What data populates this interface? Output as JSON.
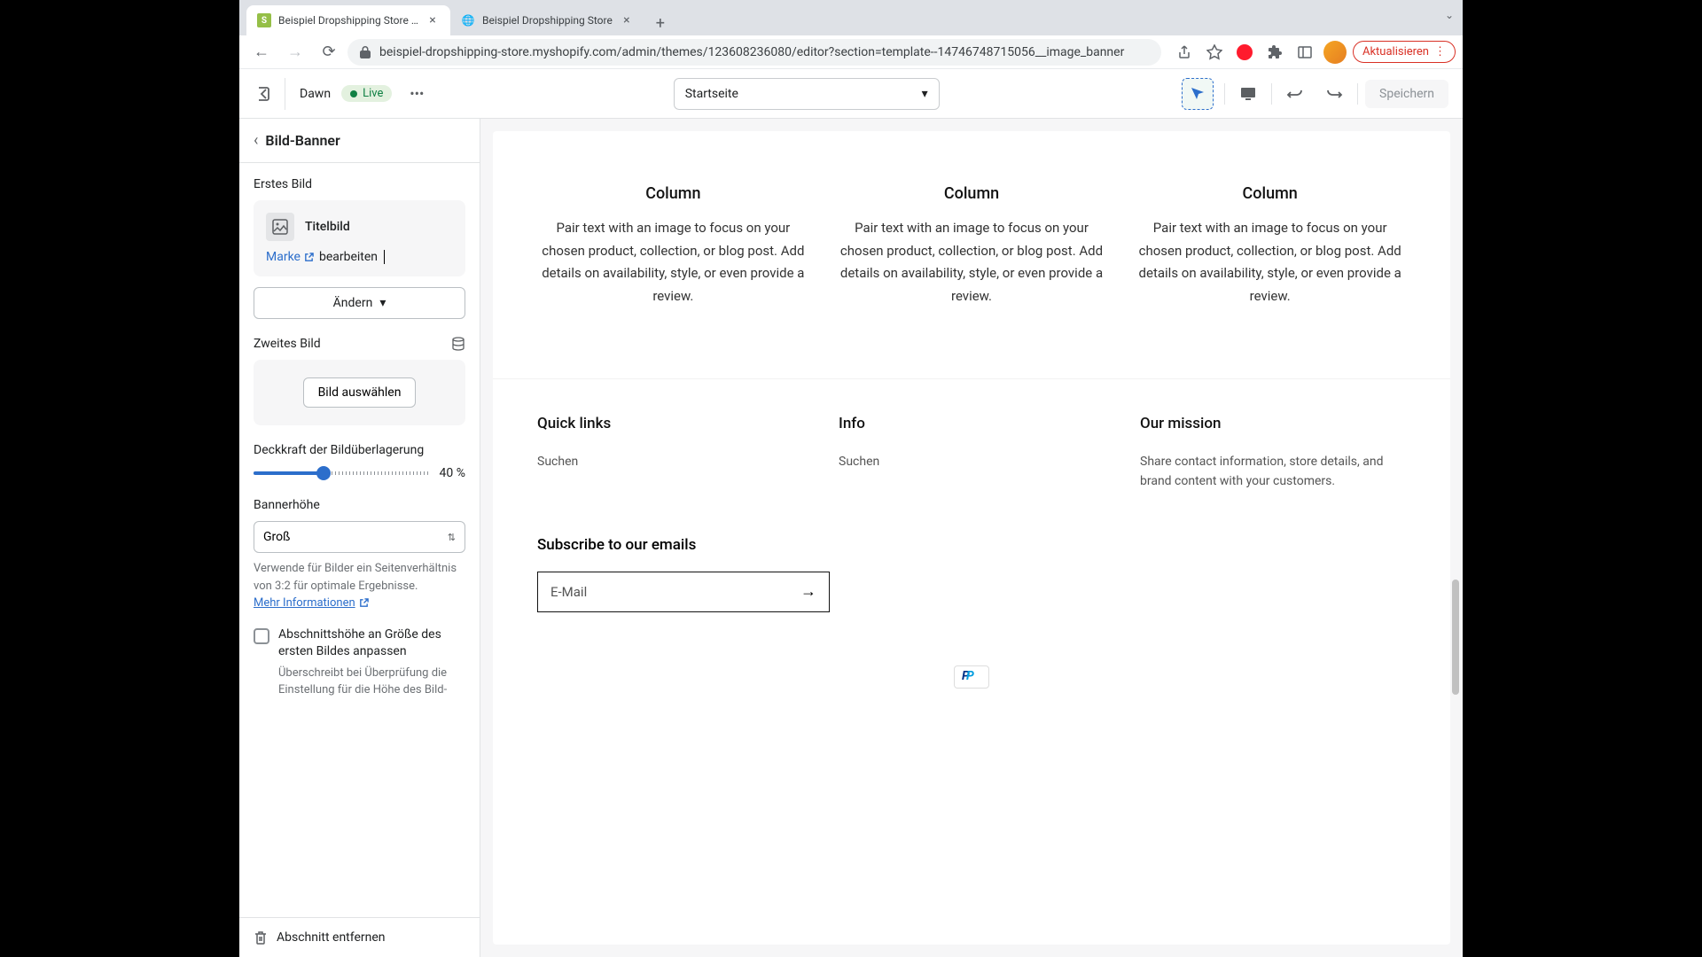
{
  "browser": {
    "tabs": [
      {
        "title": "Beispiel Dropshipping Store · D",
        "favicon_color": "#95bf47"
      },
      {
        "title": "Beispiel Dropshipping Store",
        "favicon_color": "#5c5f62"
      }
    ],
    "url": "beispiel-dropshipping-store.myshopify.com/admin/themes/123608236080/editor?section=template--14746748715056__image_banner",
    "refresh_label": "Aktualisieren"
  },
  "topbar": {
    "theme_name": "Dawn",
    "live_label": "Live",
    "page_selector": "Startseite",
    "save_label": "Speichern"
  },
  "sidebar": {
    "section_title": "Bild-Banner",
    "first_image_label": "Erstes Bild",
    "image_name": "Titelbild",
    "brand_link": "Marke",
    "edit_label": "bearbeiten",
    "change_btn": "Ändern",
    "second_image_label": "Zweites Bild",
    "select_image_btn": "Bild auswählen",
    "opacity_label": "Deckkraft der Bildüberlagerung",
    "opacity_value": "40 %",
    "opacity_percent": 40,
    "height_label": "Bannerhöhe",
    "height_value": "Groß",
    "height_help": "Verwende für Bilder ein Seitenverhältnis von 3:2 für optimale Ergebnisse.",
    "more_info": "Mehr Informationen",
    "checkbox_label": "Abschnittshöhe an Größe des ersten Bildes anpassen",
    "checkbox_help": "Überschreibt bei Überprüfung die Einstellung für die Höhe des Bild-",
    "remove_section": "Abschnitt entfernen"
  },
  "preview": {
    "columns": [
      {
        "title": "Column",
        "text": "Pair text with an image to focus on your chosen product, collection, or blog post. Add details on availability, style, or even provide a review."
      },
      {
        "title": "Column",
        "text": "Pair text with an image to focus on your chosen product, collection, or blog post. Add details on availability, style, or even provide a review."
      },
      {
        "title": "Column",
        "text": "Pair text with an image to focus on your chosen product, collection, or blog post. Add details on availability, style, or even provide a review."
      }
    ],
    "footer": {
      "quick_links_title": "Quick links",
      "quick_links_item": "Suchen",
      "info_title": "Info",
      "info_item": "Suchen",
      "mission_title": "Our mission",
      "mission_text": "Share contact information, store details, and brand content with your customers."
    },
    "subscribe": {
      "title": "Subscribe to our emails",
      "placeholder": "E-Mail"
    }
  }
}
